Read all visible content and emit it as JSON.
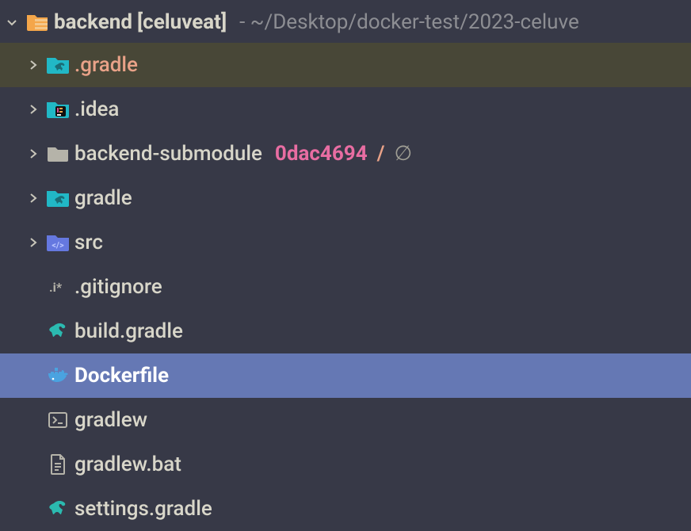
{
  "root": {
    "name": "backend",
    "bracket": "[celuveat]",
    "path": "- ~/Desktop/docker-test/2023-celuve"
  },
  "rows": [
    {
      "label": ".gradle",
      "icon_name": "gradle-folder-icon",
      "chevron": true,
      "highlight": "hover",
      "label_class": "coral"
    },
    {
      "label": ".idea",
      "icon_name": "idea-folder-icon",
      "chevron": true,
      "highlight": "",
      "label_class": ""
    },
    {
      "label": "backend-submodule",
      "icon_name": "folder-icon",
      "chevron": true,
      "highlight": "",
      "label_class": "",
      "hash": "0dac4694",
      "slash": "/",
      "empty": "∅"
    },
    {
      "label": "gradle",
      "icon_name": "gradle-folder-icon",
      "chevron": true,
      "highlight": "",
      "label_class": ""
    },
    {
      "label": "src",
      "icon_name": "src-folder-icon",
      "chevron": true,
      "highlight": "",
      "label_class": ""
    },
    {
      "label": ".gitignore",
      "icon_name": "ignore-file-icon",
      "chevron": false,
      "highlight": "",
      "label_class": ""
    },
    {
      "label": "build.gradle",
      "icon_name": "gradle-file-icon",
      "chevron": false,
      "highlight": "",
      "label_class": ""
    },
    {
      "label": "Dockerfile",
      "icon_name": "docker-file-icon",
      "chevron": false,
      "highlight": "selected",
      "label_class": "bold"
    },
    {
      "label": "gradlew",
      "icon_name": "shell-file-icon",
      "chevron": false,
      "highlight": "",
      "label_class": ""
    },
    {
      "label": "gradlew.bat",
      "icon_name": "bat-file-icon",
      "chevron": false,
      "highlight": "",
      "label_class": ""
    },
    {
      "label": "settings.gradle",
      "icon_name": "gradle-file-icon",
      "chevron": false,
      "highlight": "",
      "label_class": ""
    }
  ]
}
